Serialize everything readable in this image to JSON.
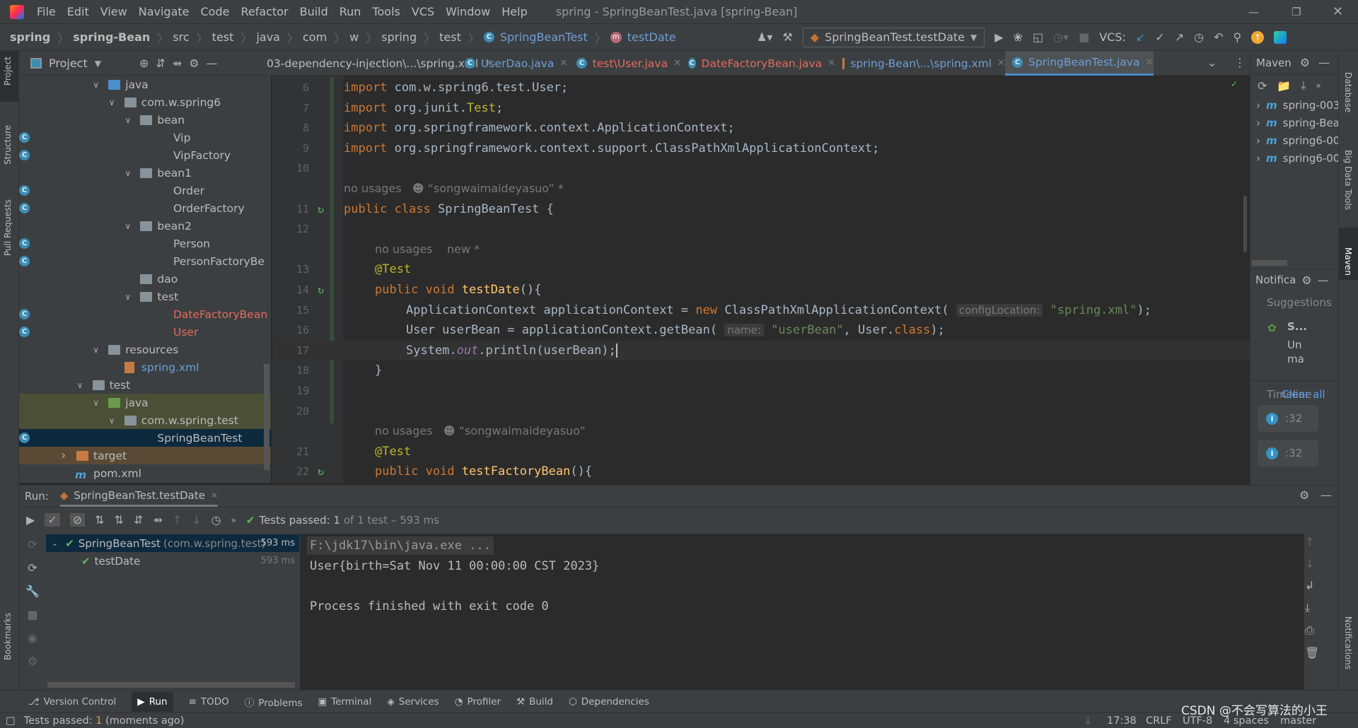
{
  "menu": [
    "File",
    "Edit",
    "View",
    "Navigate",
    "Code",
    "Refactor",
    "Build",
    "Run",
    "Tools",
    "VCS",
    "Window",
    "Help"
  ],
  "window_title": "spring - SpringBeanTest.java [spring-Bean]",
  "breadcrumb": [
    "spring",
    "spring-Bean",
    "src",
    "test",
    "java",
    "com",
    "w",
    "spring",
    "test",
    "SpringBeanTest",
    "testDate"
  ],
  "run_config": "SpringBeanTest.testDate",
  "vcs_label": "VCS:",
  "project_panel": {
    "title": "Project"
  },
  "tabs": [
    {
      "label": "03-dependency-injection\\...\\spring.xml",
      "color": "#bbbbbb",
      "icon": "xml-icon",
      "active": false
    },
    {
      "label": "UserDao.java",
      "color": "#6d9fd6",
      "icon": "class-icon",
      "active": false
    },
    {
      "label": "test\\User.java",
      "color": "#e06c5c",
      "icon": "class-icon",
      "active": false
    },
    {
      "label": "DateFactoryBean.java",
      "color": "#e06c5c",
      "icon": "class-icon",
      "active": false
    },
    {
      "label": "spring-Bean\\...\\spring.xml",
      "color": "#6d9fd6",
      "icon": "xml-icon",
      "active": false
    },
    {
      "label": "SpringBeanTest.java",
      "color": "#6d9fd6",
      "icon": "class-icon",
      "active": true
    }
  ],
  "tree": [
    {
      "label": "java",
      "d": 2,
      "type": "folder-blue",
      "open": true
    },
    {
      "label": "com.w.spring6",
      "d": 3,
      "type": "folder",
      "open": true
    },
    {
      "label": "bean",
      "d": 4,
      "type": "folder",
      "open": true
    },
    {
      "label": "Vip",
      "d": 5,
      "type": "class"
    },
    {
      "label": "VipFactory",
      "d": 5,
      "type": "class"
    },
    {
      "label": "bean1",
      "d": 4,
      "type": "folder",
      "open": true
    },
    {
      "label": "Order",
      "d": 5,
      "type": "class"
    },
    {
      "label": "OrderFactory",
      "d": 5,
      "type": "class"
    },
    {
      "label": "bean2",
      "d": 4,
      "type": "folder",
      "open": true
    },
    {
      "label": "Person",
      "d": 5,
      "type": "class"
    },
    {
      "label": "PersonFactoryBe",
      "d": 5,
      "type": "class"
    },
    {
      "label": "dao",
      "d": 4,
      "type": "folder"
    },
    {
      "label": "test",
      "d": 4,
      "type": "folder",
      "open": true
    },
    {
      "label": "DateFactoryBean",
      "d": 5,
      "type": "class",
      "color": "#e06c5c"
    },
    {
      "label": "User",
      "d": 5,
      "type": "class",
      "color": "#e06c5c"
    },
    {
      "label": "resources",
      "d": 2,
      "type": "folder",
      "open": true
    },
    {
      "label": "spring.xml",
      "d": 3,
      "type": "xml",
      "color": "#6d9fd6"
    },
    {
      "label": "test",
      "d": 1,
      "type": "folder",
      "open": true
    },
    {
      "label": "java",
      "d": 2,
      "type": "folder-green",
      "open": true,
      "bg": "#4a4f36"
    },
    {
      "label": "com.w.spring.test",
      "d": 3,
      "type": "folder",
      "open": true,
      "bg": "#4a4f36"
    },
    {
      "label": "SpringBeanTest",
      "d": 4,
      "type": "class",
      "selected": true
    },
    {
      "label": "target",
      "d": 0,
      "type": "folder-orange",
      "open": false,
      "bg": "#5a4a35"
    },
    {
      "label": "pom.xml",
      "d": 0,
      "type": "pom"
    }
  ],
  "code": [
    {
      "n": "6",
      "i": 0,
      "t": [
        [
          "kw",
          "import "
        ],
        [
          "",
          "com.w.spring6.test.User;"
        ]
      ]
    },
    {
      "n": "7",
      "i": 0,
      "t": [
        [
          "kw",
          "import "
        ],
        [
          "",
          "org.junit."
        ],
        [
          "ann",
          "Test"
        ],
        [
          "",
          ";"
        ]
      ]
    },
    {
      "n": "8",
      "i": 0,
      "t": [
        [
          "kw",
          "import "
        ],
        [
          "",
          "org.springframework.context.ApplicationContext;"
        ]
      ]
    },
    {
      "n": "9",
      "i": 0,
      "t": [
        [
          "kw",
          "import "
        ],
        [
          "",
          "org.springframework.context.support.ClassPathXmlApplicationContext;"
        ]
      ]
    },
    {
      "n": "10",
      "i": 0,
      "t": []
    },
    {
      "n": "",
      "i": 0,
      "t": [
        [
          "hint",
          "no usages   ☻ “songwaimaideyasuo” *"
        ]
      ]
    },
    {
      "n": "11",
      "i": 0,
      "t": [
        [
          "kw",
          "public class "
        ],
        [
          "",
          "SpringBeanTest {"
        ]
      ]
    },
    {
      "n": "12",
      "i": 0,
      "t": []
    },
    {
      "n": "",
      "i": 1,
      "t": [
        [
          "hint",
          "no usages    new *"
        ]
      ]
    },
    {
      "n": "13",
      "i": 1,
      "t": [
        [
          "ann",
          "@Test"
        ]
      ]
    },
    {
      "n": "14",
      "i": 1,
      "t": [
        [
          "kw",
          "public void "
        ],
        [
          "fn",
          "testDate"
        ],
        [
          "",
          "(){"
        ]
      ]
    },
    {
      "n": "15",
      "i": 2,
      "t": [
        [
          "",
          "ApplicationContext applicationContext = "
        ],
        [
          "kw",
          "new "
        ],
        [
          "",
          "ClassPathXmlApplicationContext( "
        ],
        [
          "inl",
          "configLocation:"
        ],
        [
          "",
          " "
        ],
        [
          "str",
          "\"spring.xml\""
        ],
        [
          "",
          ");"
        ]
      ]
    },
    {
      "n": "16",
      "i": 2,
      "t": [
        [
          "",
          "User userBean = applicationContext.getBean( "
        ],
        [
          "inl",
          "name:"
        ],
        [
          "",
          " "
        ],
        [
          "str",
          "\"userBean\""
        ],
        [
          "",
          ", User."
        ],
        [
          "kw",
          "class"
        ],
        [
          "",
          ");"
        ]
      ]
    },
    {
      "n": "17",
      "i": 2,
      "t": [
        [
          "",
          "System."
        ],
        [
          "it",
          "out"
        ],
        [
          "",
          ".println(userBean);"
        ]
      ],
      "current": true
    },
    {
      "n": "18",
      "i": 1,
      "t": [
        [
          "",
          "}"
        ]
      ]
    },
    {
      "n": "19",
      "i": 0,
      "t": []
    },
    {
      "n": "20",
      "i": 0,
      "t": []
    },
    {
      "n": "",
      "i": 1,
      "t": [
        [
          "hint",
          "no usages   ☻ “songwaimaideyasuo”"
        ]
      ]
    },
    {
      "n": "21",
      "i": 1,
      "t": [
        [
          "ann",
          "@Test"
        ]
      ]
    },
    {
      "n": "22",
      "i": 1,
      "t": [
        [
          "kw",
          "public void "
        ],
        [
          "fn",
          "testFactoryBean"
        ],
        [
          "",
          "(){"
        ]
      ]
    }
  ],
  "maven": {
    "title": "Maven",
    "projects": [
      "spring-003",
      "spring-Bean",
      "spring6-00",
      "spring6-00"
    ]
  },
  "notifications": {
    "title": "Notifica",
    "suggestions": "Suggestions",
    "item_title": "S...",
    "item_text1": "Un",
    "item_text2": "ma",
    "timeline": "Timeline",
    "clear_all": "Clear all",
    "entries": [
      ":32",
      ":32"
    ]
  },
  "right_stripe": [
    "Database",
    "Big Data Tools",
    "Maven"
  ],
  "left_stripe": [
    "Project",
    "Structure",
    "Pull Requests",
    "Bookmarks"
  ],
  "run": {
    "label": "Run:",
    "tab": "SpringBeanTest.testDate",
    "status_prefix": "Tests passed:",
    "status_count": "1",
    "status_rest": "of 1 test – 593 ms",
    "tests": [
      {
        "name": "SpringBeanTest",
        "pkg": "(com.w.spring.test)",
        "time": "593 ms"
      },
      {
        "name": "testDate",
        "time": "593 ms"
      }
    ],
    "console": [
      "F:\\jdk17\\bin\\java.exe ...",
      "User{birth=Sat Nov 11 00:00:00 CST 2023}",
      "",
      "Process finished with exit code 0"
    ]
  },
  "bottom_tools": [
    "Version Control",
    "Run",
    "TODO",
    "Problems",
    "Terminal",
    "Services",
    "Profiler",
    "Build",
    "Dependencies"
  ],
  "status": {
    "message_prefix": "Tests passed:",
    "message_count": "1",
    "message_rest": "(moments ago)",
    "position": "17:38",
    "line_sep": "CRLF",
    "encoding": "UTF-8",
    "indent": "4 spaces",
    "branch": "master",
    "watermark": "CSDN @不会写算法的小王"
  },
  "colors": {
    "accent": "#4a88c7",
    "pass": "#5fb85f",
    "bg": "#2b2b2b",
    "panel": "#3c3f41"
  }
}
